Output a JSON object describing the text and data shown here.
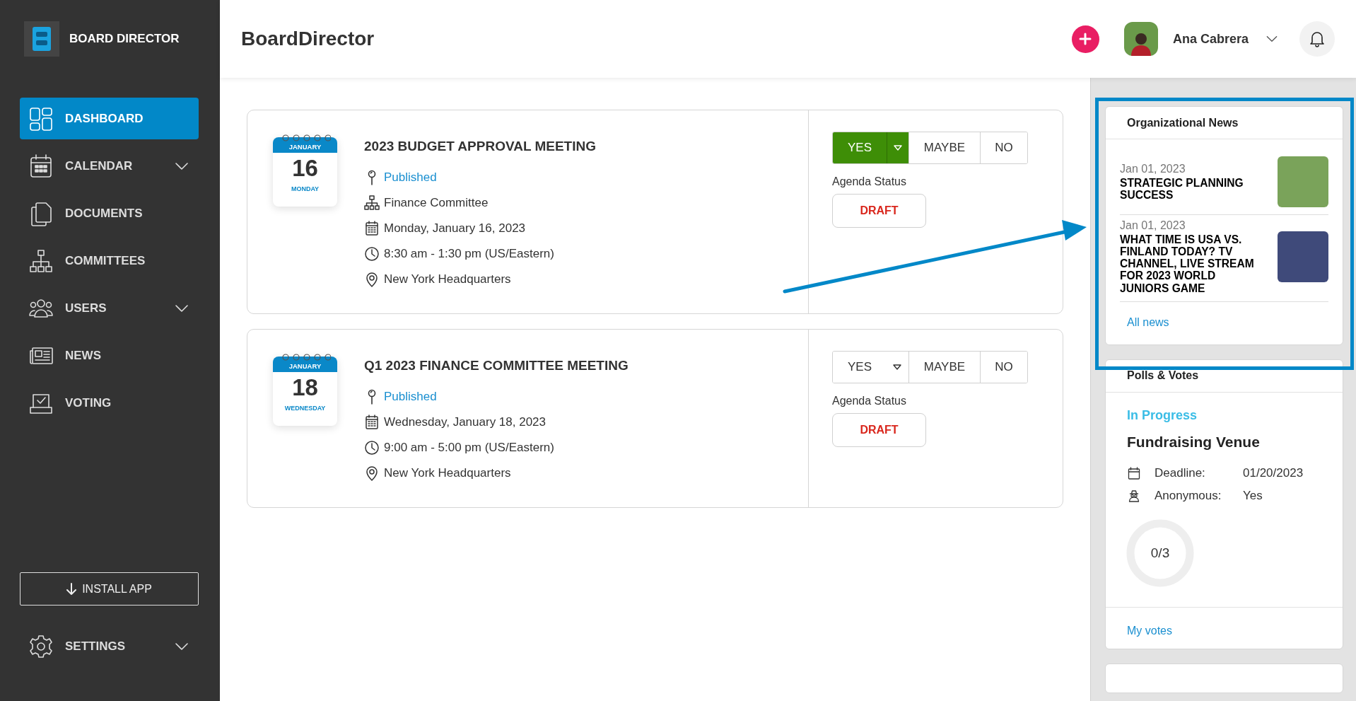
{
  "sidebar": {
    "brand": "BOARD DIRECTOR",
    "items": [
      {
        "kind": "dashboard",
        "label": "DASHBOARD",
        "selected": true,
        "has_submenu": false
      },
      {
        "kind": "calendar",
        "label": "CALENDAR",
        "selected": false,
        "has_submenu": true
      },
      {
        "kind": "documents",
        "label": "DOCUMENTS",
        "selected": false,
        "has_submenu": false
      },
      {
        "kind": "committees",
        "label": "COMMITTEES",
        "selected": false,
        "has_submenu": false
      },
      {
        "kind": "users",
        "label": "USERS",
        "selected": false,
        "has_submenu": true
      },
      {
        "kind": "news",
        "label": "NEWS",
        "selected": false,
        "has_submenu": false
      },
      {
        "kind": "voting",
        "label": "VOTING",
        "selected": false,
        "has_submenu": false
      }
    ],
    "install_button": "INSTALL APP",
    "settings": {
      "label": "SETTINGS",
      "has_submenu": true
    }
  },
  "header": {
    "title": "BoardDirector",
    "user_name": "Ana Cabrera"
  },
  "meetings": [
    {
      "month": "JANUARY",
      "day": "16",
      "weekday": "MONDAY",
      "title": "2023 BUDGET APPROVAL MEETING",
      "status": "Published",
      "details": [
        {
          "kind": "committee",
          "text": "Finance Committee"
        },
        {
          "kind": "date",
          "text": "Monday, January 16, 2023"
        },
        {
          "kind": "time",
          "text": "8:30 am - 1:30 pm (US/Eastern)"
        },
        {
          "kind": "location",
          "text": "New York Headquarters"
        }
      ],
      "rsvp": [
        {
          "label": "YES",
          "selected": true,
          "has_dropdown": true
        },
        {
          "label": "MAYBE",
          "selected": false,
          "has_dropdown": false
        },
        {
          "label": "NO",
          "selected": false,
          "has_dropdown": false
        }
      ],
      "agenda_label": "Agenda Status",
      "agenda_status": "DRAFT"
    },
    {
      "month": "JANUARY",
      "day": "18",
      "weekday": "WEDNESDAY",
      "title": "Q1 2023 FINANCE COMMITTEE MEETING",
      "status": "Published",
      "details": [
        {
          "kind": "date",
          "text": "Wednesday, January 18, 2023"
        },
        {
          "kind": "time",
          "text": "9:00 am - 5:00 pm (US/Eastern)"
        },
        {
          "kind": "location",
          "text": "New York Headquarters"
        }
      ],
      "rsvp": [
        {
          "label": "YES",
          "selected": false,
          "has_dropdown": true
        },
        {
          "label": "MAYBE",
          "selected": false,
          "has_dropdown": false
        },
        {
          "label": "NO",
          "selected": false,
          "has_dropdown": false
        }
      ],
      "agenda_label": "Agenda Status",
      "agenda_status": "DRAFT"
    }
  ],
  "news": {
    "title": "Organizational News",
    "items": [
      {
        "date": "Jan 01, 2023",
        "headline": "STRATEGIC PLANNING SUCCESS"
      },
      {
        "date": "Jan 01, 2023",
        "headline": "WHAT TIME IS USA VS. FINLAND TODAY? TV CHANNEL, LIVE STREAM FOR 2023 WORLD JUNIORS GAME"
      }
    ],
    "link": "All news"
  },
  "polls": {
    "title": "Polls & Votes",
    "status": "In Progress",
    "name": "Fundraising Venue",
    "rows": [
      {
        "kind": "deadline",
        "label": "Deadline:",
        "value": "01/20/2023"
      },
      {
        "kind": "anonymous",
        "label": "Anonymous:",
        "value": "Yes"
      }
    ],
    "progress": "0/3",
    "link": "My votes"
  }
}
